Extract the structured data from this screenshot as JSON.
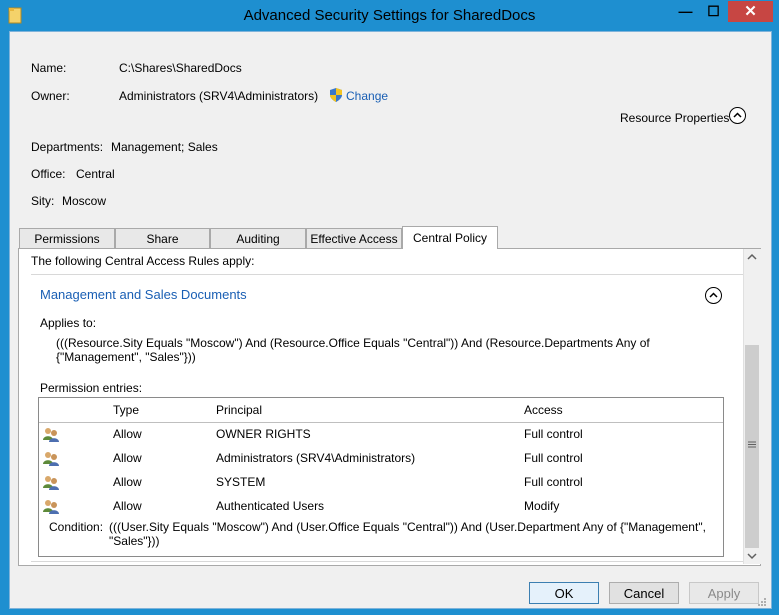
{
  "window": {
    "title": "Advanced Security Settings for SharedDocs"
  },
  "header": {
    "name_label": "Name:",
    "name_value": "C:\\Shares\\SharedDocs",
    "owner_label": "Owner:",
    "owner_value": "Administrators (SRV4\\Administrators)",
    "change_link": "Change",
    "resource_properties": "Resource Properties"
  },
  "resource_properties": [
    {
      "label": "Departments:",
      "value": "Management; Sales"
    },
    {
      "label": "Office:",
      "value": "Central"
    },
    {
      "label": "Sity:",
      "value": "Moscow"
    }
  ],
  "tabs": [
    {
      "label": "Permissions"
    },
    {
      "label": "Share"
    },
    {
      "label": "Auditing"
    },
    {
      "label": "Effective Access"
    },
    {
      "label": "Central Policy"
    }
  ],
  "active_tab": "Central Policy",
  "policy": {
    "intro": "The following Central Access Rules apply:",
    "rule_title": "Management and Sales Documents",
    "applies_to_label": "Applies to:",
    "applies_to_line1": "(((Resource.Sity Equals \"Moscow\") And (Resource.Office Equals \"Central\")) And (Resource.Departments Any of",
    "applies_to_line2": "{\"Management\", \"Sales\"}))",
    "permission_entries_label": "Permission entries:",
    "columns": {
      "type": "Type",
      "principal": "Principal",
      "access": "Access"
    },
    "entries": [
      {
        "type": "Allow",
        "principal": "OWNER RIGHTS",
        "access": "Full control"
      },
      {
        "type": "Allow",
        "principal": "Administrators (SRV4\\Administrators)",
        "access": "Full control"
      },
      {
        "type": "Allow",
        "principal": "SYSTEM",
        "access": "Full control"
      },
      {
        "type": "Allow",
        "principal": "Authenticated Users",
        "access": "Modify"
      }
    ],
    "condition_label": "Condition:",
    "condition_line1": "(((User.Sity Equals \"Moscow\") And (User.Office Equals \"Central\")) And (User.Department Any of {\"Management\",",
    "condition_line2": "\"Sales\"}))"
  },
  "buttons": {
    "ok": "OK",
    "cancel": "Cancel",
    "apply": "Apply"
  },
  "window_controls": {
    "minimize": "—",
    "maximize": "☐",
    "close": "✕"
  },
  "icons": {
    "folder": "folder-icon",
    "shield": "uac-shield-icon",
    "user": "user-group-icon"
  },
  "colors": {
    "titlebar": "#1e8fd0",
    "link": "#1a5fb4",
    "close": "#c74643"
  }
}
